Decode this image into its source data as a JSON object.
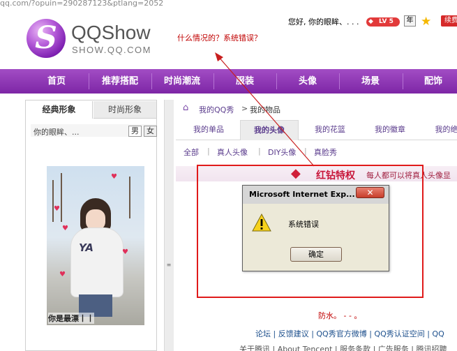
{
  "browser": {
    "url_fragment": "qq.com/?opuin=290287123&ptlang=2052"
  },
  "logo": {
    "title": "QQShow",
    "subtitle": "SHOW.QQ.COM",
    "glyph": "S"
  },
  "annotation": {
    "text": "什么情况的？系统错误？"
  },
  "header": {
    "greeting": "您好, 你的眼眸、. . .",
    "level_badge": "LV 5",
    "year_badge": "年",
    "star_badge_icon": "star-icon",
    "renew_label": "续费"
  },
  "nav": {
    "items": [
      "首页",
      "推荐搭配",
      "时尚潮流",
      "服装",
      "头像",
      "场景",
      "配饰"
    ]
  },
  "left_panel": {
    "tab_classic": "经典形象",
    "tab_fashion": "时尚形象",
    "name": "你的眼眸、...",
    "sex_male": "男",
    "sex_female": "女",
    "photo_caption": "你是最漂丨丨"
  },
  "breadcrumb": {
    "home": "我的QQ秀",
    "separator": ">",
    "current": "我的物品"
  },
  "subtabs": [
    "我的单品",
    "我的头像",
    "我的花篮",
    "我的徽章",
    "我的绝"
  ],
  "filters": [
    "全部",
    "真人头像",
    "DIY头像",
    "真脸秀"
  ],
  "privilege": {
    "title": "红钻特权",
    "desc": "每人都可以将真人头像显"
  },
  "dialog": {
    "title": "Microsoft Internet Exp...",
    "close_label": "✕",
    "message": "系统错误",
    "ok_label": "确定"
  },
  "footer": {
    "red_text": "防水。 - - 。",
    "links_row": "论坛 | 反馈建议 | QQ秀官方微博 | QQ秀认证空间 | QQ",
    "links_row2": "关于腾讯 | About Tencent | 服务条款 | 广告服务 | 腾讯招聘"
  },
  "colors": {
    "nav_purple": "#8e35b4",
    "alert_red": "#e01a1a",
    "link_purple": "#5a3b8c"
  }
}
